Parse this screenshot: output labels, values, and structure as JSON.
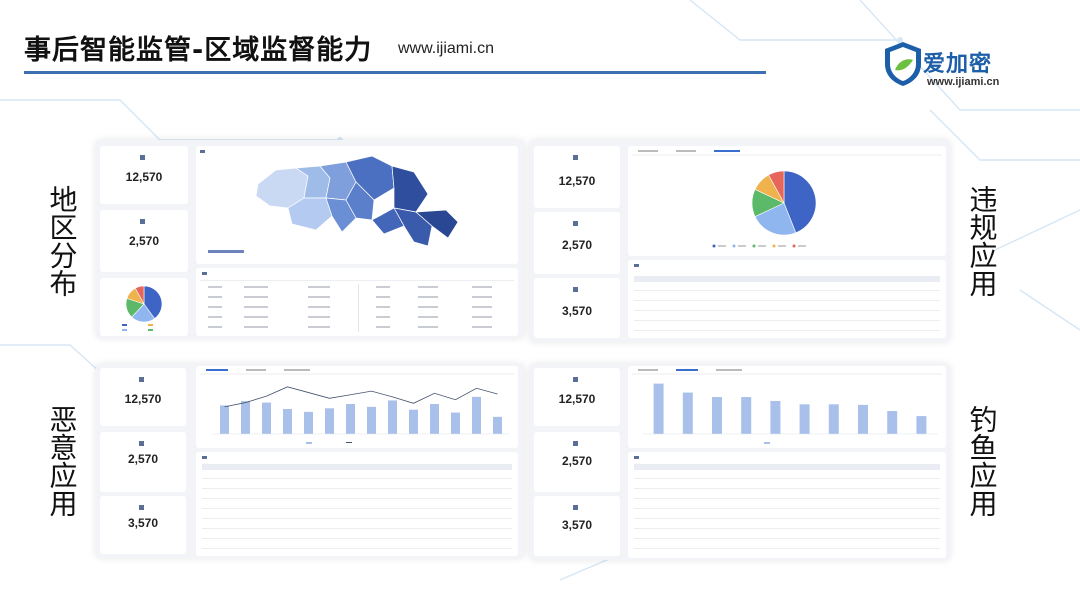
{
  "slide": {
    "title": "事后智能监管-区域监督能力",
    "url": "www.ijiami.cn"
  },
  "logo": {
    "name": "爱加密",
    "url": "www.ijiami.cn"
  },
  "labels": {
    "region": "地区分布",
    "violation": "违规应用",
    "malicious": "恶意应用",
    "phishing": "钓鱼应用"
  },
  "panels": {
    "region": {
      "stats": [
        "12,570",
        "2,570"
      ]
    },
    "violation": {
      "stats": [
        "12,570",
        "2,570",
        "3,570"
      ]
    },
    "malicious": {
      "stats": [
        "12,570",
        "2,570",
        "3,570"
      ]
    },
    "phishing": {
      "stats": [
        "12,570",
        "2,570",
        "3,570"
      ]
    }
  },
  "colors": {
    "accent": "#3d6fb3",
    "map_dark": "#2f4f9e",
    "map_light": "#b9cdf0",
    "bar": "#a9c1ea",
    "line": "#44536e",
    "pie": [
      "#3e64c6",
      "#8fb6ef",
      "#5cb96a",
      "#f0b24c",
      "#e6665c"
    ]
  },
  "chart_data": [
    {
      "type": "pie",
      "panel": "violation",
      "values": [
        44,
        24,
        14,
        10,
        8
      ]
    },
    {
      "type": "pie",
      "panel": "region",
      "values": [
        40,
        22,
        18,
        12,
        8
      ]
    },
    {
      "type": "bar",
      "panel": "malicious",
      "values": [
        40,
        46,
        44,
        35,
        31,
        36,
        42,
        38,
        47,
        34,
        42,
        30,
        52,
        24
      ],
      "line": [
        38,
        44,
        53,
        66,
        58,
        50,
        55,
        60,
        52,
        43,
        57,
        48,
        64,
        56
      ]
    },
    {
      "type": "bar",
      "panel": "phishing",
      "values": [
        90,
        74,
        66,
        66,
        59,
        53,
        53,
        52,
        41,
        32
      ]
    }
  ]
}
